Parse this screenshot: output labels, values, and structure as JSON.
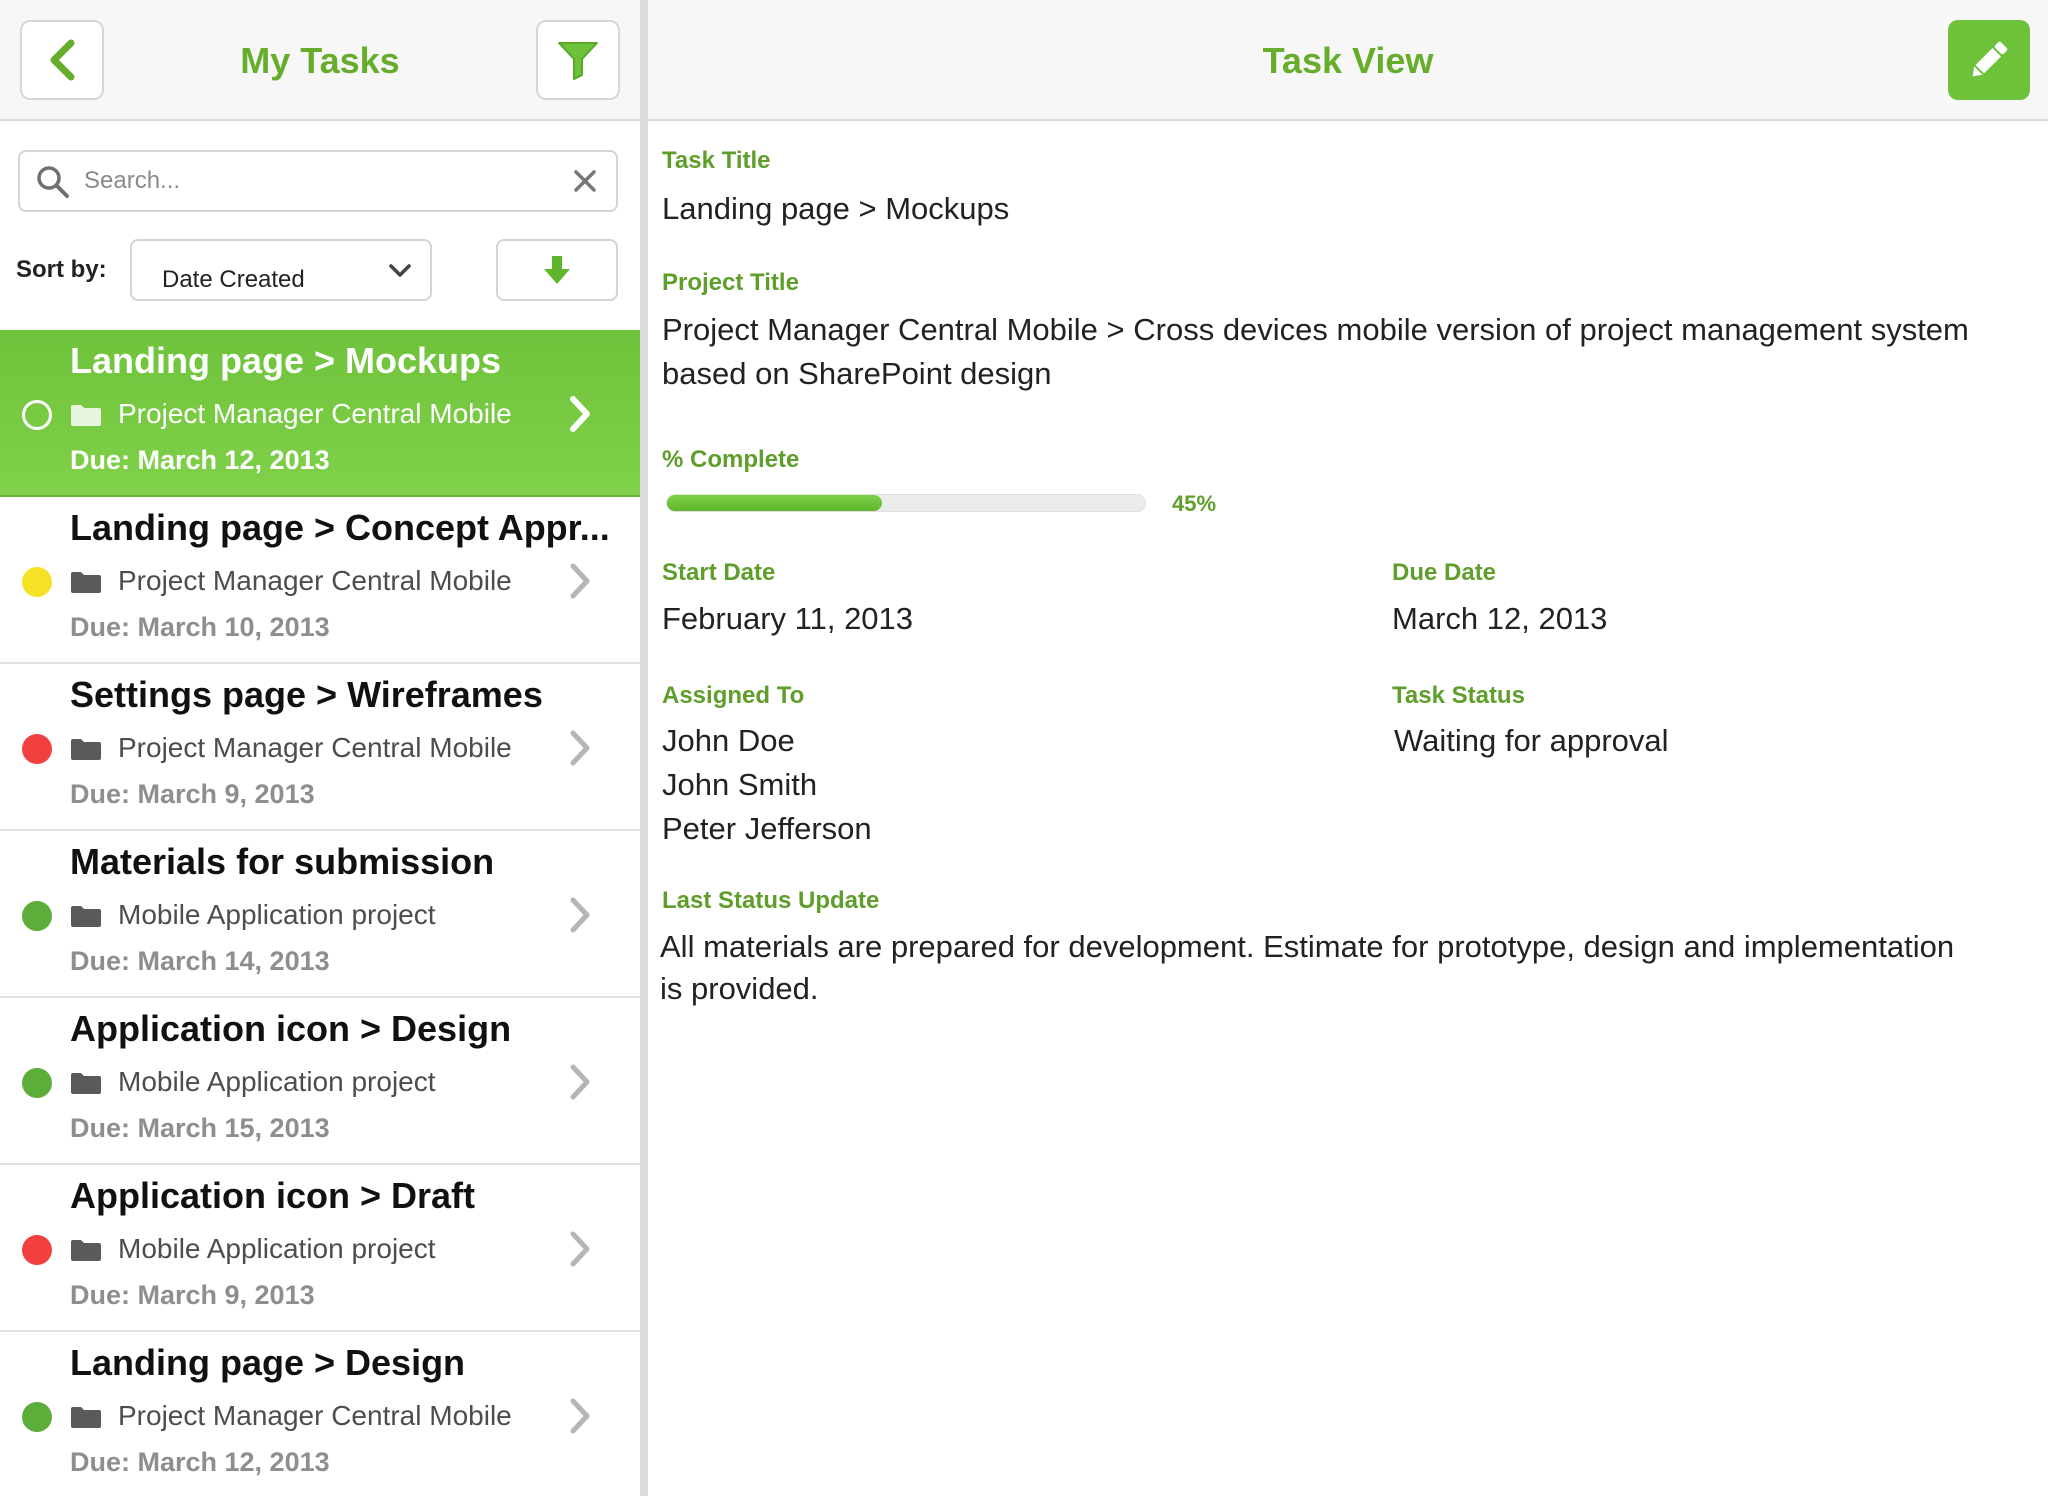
{
  "colors": {
    "accent": "#65ad2a",
    "active_row": "#74c640",
    "yellow": "#f5e225",
    "red": "#f24040",
    "green": "#5dad3a"
  },
  "left_nav": {
    "title": "My Tasks",
    "back_icon": "chevron-left-icon",
    "filter_icon": "funnel-icon"
  },
  "search": {
    "placeholder": "Search...",
    "value": ""
  },
  "sort": {
    "label": "Sort by:",
    "selected": "Date Created",
    "direction_icon": "arrow-down-icon"
  },
  "tasks": [
    {
      "title": "Landing page > Mockups",
      "project": "Project Manager Central Mobile",
      "due": "Due: March 12, 2013",
      "status": "selected",
      "active": true
    },
    {
      "title": "Landing page > Concept Appr...",
      "project": "Project Manager Central Mobile",
      "due": "Due: March 10, 2013",
      "status": "yellow"
    },
    {
      "title": "Settings page > Wireframes",
      "project": "Project Manager Central Mobile",
      "due": "Due: March 9, 2013",
      "status": "red"
    },
    {
      "title": "Materials for submission",
      "project": "Mobile Application project",
      "due": "Due: March 14, 2013",
      "status": "green"
    },
    {
      "title": "Application icon > Design",
      "project": "Mobile Application project",
      "due": "Due: March 15, 2013",
      "status": "green"
    },
    {
      "title": "Application icon > Draft",
      "project": "Mobile Application project",
      "due": "Due: March 9, 2013",
      "status": "red"
    },
    {
      "title": "Landing page > Design",
      "project": "Project Manager Central Mobile",
      "due": "Due: March 12, 2013",
      "status": "green"
    }
  ],
  "right_nav": {
    "title": "Task View",
    "edit_icon": "pencil-icon"
  },
  "task_view": {
    "task_title_label": "Task Title",
    "task_title": "Landing page > Mockups",
    "project_title_label": "Project Title",
    "project_title_line1": "Project Manager Central Mobile > Cross devices mobile version of project management system",
    "project_title_line2": "based on SharePoint design",
    "complete_label": "% Complete",
    "complete_percent": 45,
    "complete_text": "45%",
    "start_date_label": "Start Date",
    "start_date": "February 11, 2013",
    "due_date_label": "Due Date",
    "due_date": "March 12, 2013",
    "assigned_label": "Assigned To",
    "assigned": [
      "John Doe",
      "John Smith",
      "Peter Jefferson"
    ],
    "status_label": "Task Status",
    "status": "Waiting for approval",
    "last_update_label": "Last Status Update",
    "last_update_line1": "All materials are prepared for development. Estimate for prototype, design and implementation",
    "last_update_line2": "is provided."
  }
}
